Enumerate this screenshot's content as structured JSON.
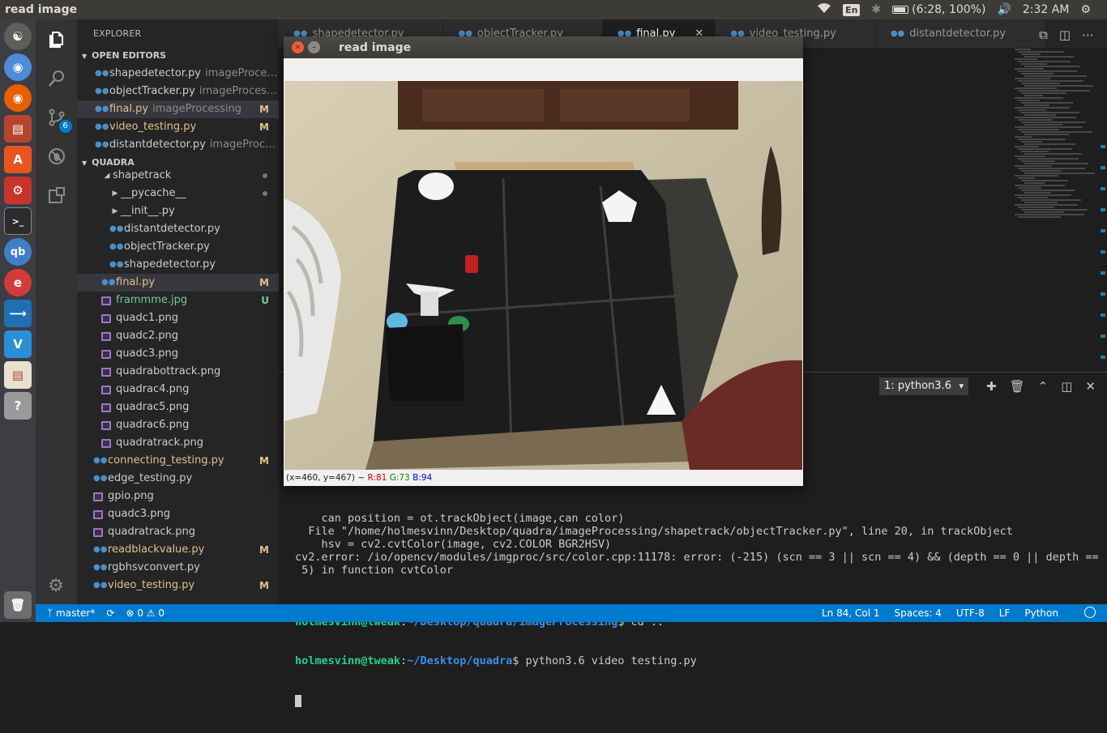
{
  "top_panel": {
    "app_title": "read image",
    "keyboard_layout": "En",
    "battery_text": "(6:28, 100%)",
    "clock": "2:32 AM"
  },
  "launcher": {
    "items": [
      "ubuntu-dash-icon",
      "chromium-icon",
      "firefox-icon",
      "files-icon",
      "software-center-icon",
      "system-settings-icon",
      "terminal-icon",
      "qbittorrent-icon",
      "text-editor-icon",
      "vscode-icon",
      "vnc-viewer-icon",
      "document-viewer-icon",
      "unknown-app-icon",
      "trash-icon"
    ]
  },
  "activity_bar": {
    "scm_badge": "6"
  },
  "explorer": {
    "title": "EXPLORER",
    "open_editors_label": "OPEN EDITORS",
    "open_editors": [
      {
        "name": "shapedetector.py",
        "desc": "imageProcess...",
        "badge": ""
      },
      {
        "name": "objectTracker.py",
        "desc": "imageProcessi...",
        "badge": ""
      },
      {
        "name": "final.py",
        "desc": "imageProcessing",
        "badge": "M"
      },
      {
        "name": "video_testing.py",
        "desc": "",
        "badge": "M"
      },
      {
        "name": "distantdetector.py",
        "desc": "imageProce...",
        "badge": ""
      }
    ],
    "workspace_label": "QUADRA",
    "tree": [
      {
        "name": "shapetrack",
        "kind": "folder-open",
        "indent": 2,
        "badge": "dot"
      },
      {
        "name": "__pycache__",
        "kind": "folder",
        "indent": 3,
        "badge": "dot"
      },
      {
        "name": "__init__.py",
        "kind": "folder",
        "indent": 3,
        "badge": ""
      },
      {
        "name": "distantdetector.py",
        "kind": "py",
        "indent": 3,
        "badge": ""
      },
      {
        "name": "objectTracker.py",
        "kind": "py",
        "indent": 3,
        "badge": ""
      },
      {
        "name": "shapedetector.py",
        "kind": "py",
        "indent": 3,
        "badge": ""
      },
      {
        "name": "final.py",
        "kind": "py",
        "indent": 2,
        "badge": "M"
      },
      {
        "name": "frammme.jpg",
        "kind": "img",
        "indent": 2,
        "badge": "U"
      },
      {
        "name": "quadc1.png",
        "kind": "img",
        "indent": 2,
        "badge": ""
      },
      {
        "name": "quadc2.png",
        "kind": "img",
        "indent": 2,
        "badge": ""
      },
      {
        "name": "quadc3.png",
        "kind": "img",
        "indent": 2,
        "badge": ""
      },
      {
        "name": "quadrabottrack.png",
        "kind": "img",
        "indent": 2,
        "badge": ""
      },
      {
        "name": "quadrac4.png",
        "kind": "img",
        "indent": 2,
        "badge": ""
      },
      {
        "name": "quadrac5.png",
        "kind": "img",
        "indent": 2,
        "badge": ""
      },
      {
        "name": "quadrac6.png",
        "kind": "img",
        "indent": 2,
        "badge": ""
      },
      {
        "name": "quadratrack.png",
        "kind": "img",
        "indent": 2,
        "badge": ""
      },
      {
        "name": "connecting_testing.py",
        "kind": "py",
        "indent": 1,
        "badge": "M"
      },
      {
        "name": "edge_testing.py",
        "kind": "py",
        "indent": 1,
        "badge": ""
      },
      {
        "name": "gpio.png",
        "kind": "img",
        "indent": 1,
        "badge": ""
      },
      {
        "name": "quadc3.png",
        "kind": "img",
        "indent": 1,
        "badge": ""
      },
      {
        "name": "quadratrack.png",
        "kind": "img",
        "indent": 1,
        "badge": ""
      },
      {
        "name": "readblackvalue.py",
        "kind": "py",
        "indent": 1,
        "badge": "M"
      },
      {
        "name": "rgbhsvconvert.py",
        "kind": "py",
        "indent": 1,
        "badge": ""
      },
      {
        "name": "video_testing.py",
        "kind": "py",
        "indent": 1,
        "badge": "M"
      }
    ]
  },
  "tabs": [
    {
      "label": "shapedetector.py",
      "active": false
    },
    {
      "label": "objectTracker.py",
      "active": false
    },
    {
      "label": "final.py",
      "active": true
    },
    {
      "label": "video_testing.py",
      "active": false
    },
    {
      "label": "distantdetector.py",
      "active": false
    }
  ],
  "terminal": {
    "selected_shell": "1: python3.6",
    "lines": [
      {
        "text": "    can position = ot.trackObject(image,can color)"
      },
      {
        "text": "  File \"/home/holmesvinn/Desktop/quadra/imageProcessing/shapetrack/objectTracker.py\", line 20, in trackObject"
      },
      {
        "text": "    hsv = cv2.cvtColor(image, cv2.COLOR BGR2HSV)"
      },
      {
        "text": "cv2.error: /io/opencv/modules/imgproc/src/color.cpp:11178: error: (-215) (scn == 3 || scn == 4) && (depth == 0 || depth =="
      },
      {
        "text": " 5) in function cvtColor"
      },
      {
        "text": ""
      }
    ],
    "prompt1_user": "holmesvinn@tweak",
    "prompt1_path": "~/Desktop/quadra/imageProcessing",
    "prompt1_cmd": "$ cd ..",
    "prompt2_user": "holmesvinn@tweak",
    "prompt2_path": "~/Desktop/quadra",
    "prompt2_cmd": "$ python3.6 video testing.py"
  },
  "status_bar": {
    "branch": "master*",
    "errors": "0",
    "warnings": "0",
    "position": "Ln 84, Col 1",
    "spaces": "Spaces: 4",
    "encoding": "UTF-8",
    "eol": "LF",
    "language": "Python"
  },
  "cv_window": {
    "title": "read image",
    "coords": "(x=460, y=467) ~",
    "r": "R:81",
    "g": "G:73",
    "b": "B:94"
  },
  "colors": {
    "vscode_blue": "#007acc",
    "modified": "#e2c08d",
    "untracked": "#73c991",
    "terminal_green": "#23d18b",
    "terminal_blue": "#3b8eea"
  }
}
